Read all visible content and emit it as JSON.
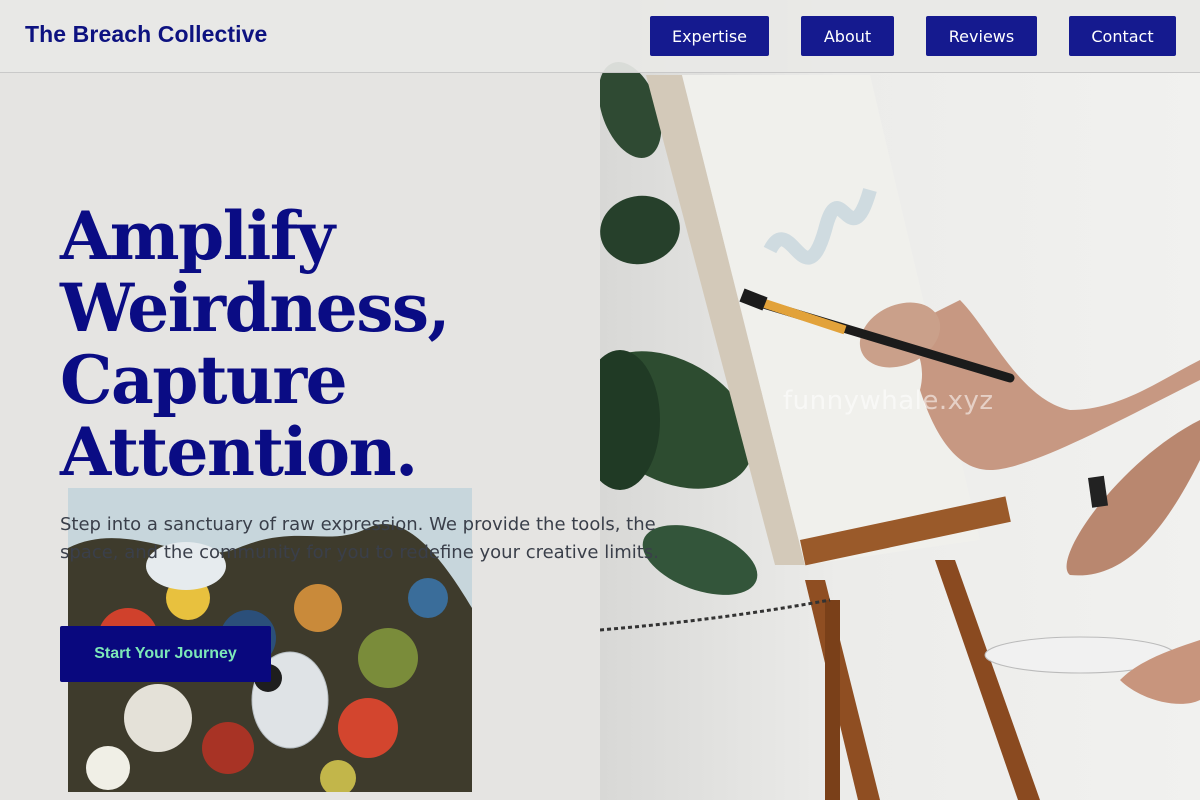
{
  "header": {
    "brand": "The Breach Collective",
    "nav": [
      {
        "label": "Expertise"
      },
      {
        "label": "About"
      },
      {
        "label": "Reviews"
      },
      {
        "label": "Contact"
      }
    ]
  },
  "hero": {
    "headline_lines": [
      "Amplify",
      "Weirdness,",
      "Capture",
      "Attention."
    ],
    "subtext": "Step into a sanctuary of raw expression. We provide the tools, the space, and the community for you to redefine your creative limits.",
    "cta_label": "Start Your Journey"
  },
  "watermark": "funnywhale.xyz",
  "colors": {
    "brand": "#0d1280",
    "nav_button_bg": "#151a8f",
    "cta_bg": "#09087e",
    "cta_text": "#7de8b8",
    "page_bg": "#e5e4e2"
  }
}
